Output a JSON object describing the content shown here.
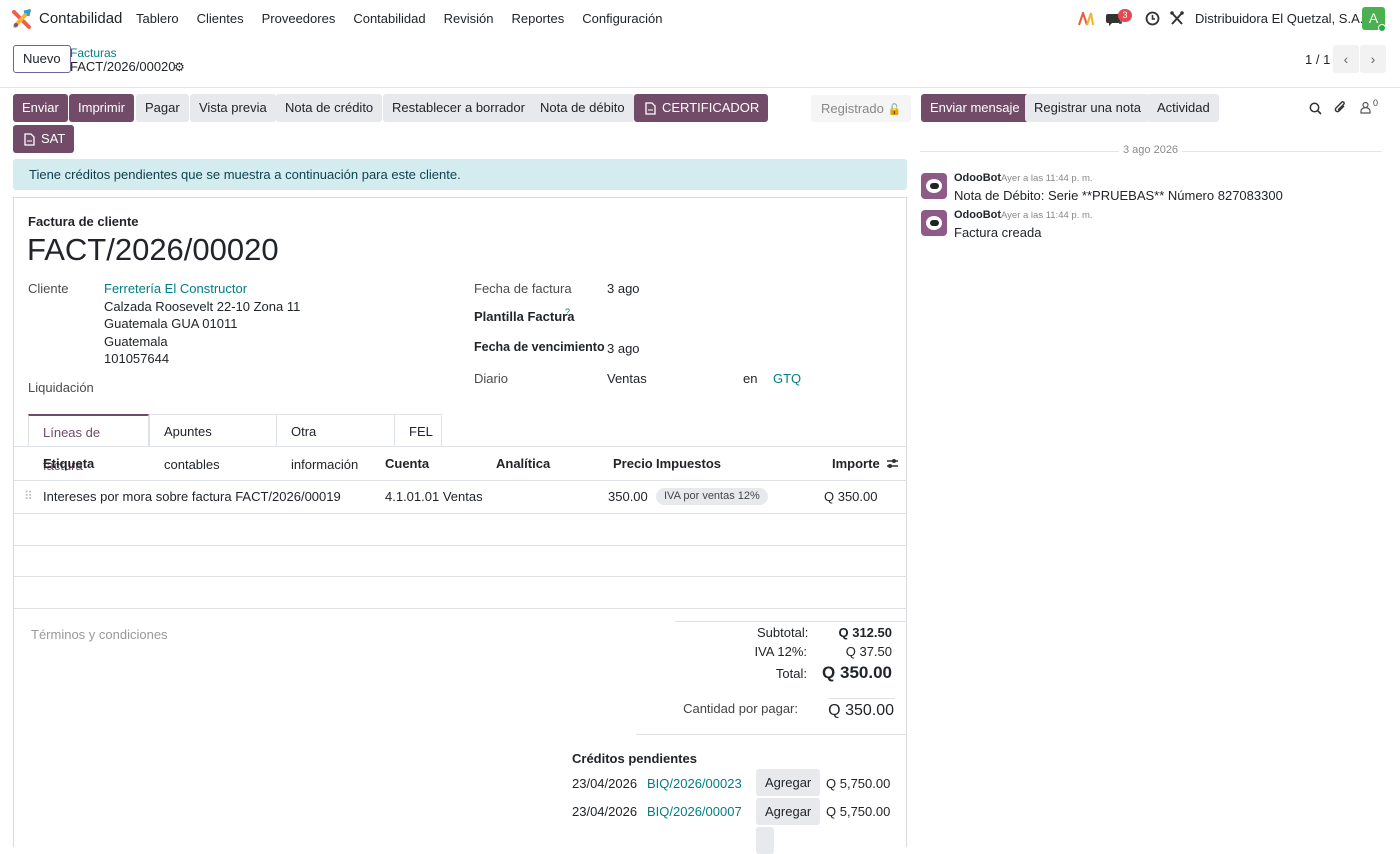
{
  "nav": {
    "app_name": "Contabilidad",
    "menu": [
      "Tablero",
      "Clientes",
      "Proveedores",
      "Contabilidad",
      "Revisión",
      "Reportes",
      "Configuración"
    ],
    "messages_count": "3",
    "company": "Distribuidora El Quetzal, S.A.",
    "user_initial": "A"
  },
  "control": {
    "new_label": "Nuevo",
    "breadcrumb_parent": "Facturas",
    "breadcrumb_current": "FACT/2026/00020",
    "pager": "1 / 1"
  },
  "actions": {
    "send": "Enviar",
    "print": "Imprimir",
    "pay": "Pagar",
    "preview": "Vista previa",
    "credit_note": "Nota de crédito",
    "reset_draft": "Restablecer a borrador",
    "debit_note": "Nota de débito",
    "certificador": "CERTIFICADOR",
    "sat": "SAT",
    "status": "Registrado"
  },
  "alert": {
    "pre": "Tiene",
    "bold": "créditos pendientes",
    "post": "que se muestra a continuación para este cliente."
  },
  "form": {
    "type_label": "Factura de cliente",
    "number": "FACT/2026/00020",
    "customer_label": "Cliente",
    "customer_name": "Ferretería El Constructor",
    "address1": "Calzada Roosevelt 22-10 Zona 11",
    "address2": "Guatemala GUA 01011",
    "address3": "Guatemala",
    "address4": "101057644",
    "liquidacion_label": "Liquidación",
    "invoice_date_label": "Fecha de factura",
    "invoice_date": "3 ago",
    "template_label": "Plantilla Factura",
    "template_help": "?",
    "due_date_label": "Fecha de vencimiento",
    "due_date": "3 ago",
    "journal_label": "Diario",
    "journal": "Ventas",
    "currency_in": "en",
    "currency": "GTQ"
  },
  "tabs": [
    "Líneas de factura",
    "Apuntes contables",
    "Otra información",
    "FEL"
  ],
  "lines": {
    "headers": [
      "Etiqueta",
      "Cuenta",
      "Analítica",
      "Precio",
      "Impuestos",
      "Importe"
    ],
    "rows": [
      {
        "label": "Intereses por mora sobre factura FACT/2026/00019",
        "account": "4.1.01.01 Ventas",
        "analytic": "",
        "price": "350.00",
        "tax": "IVA por ventas 12%",
        "amount": "Q 350.00"
      }
    ]
  },
  "terms_placeholder": "Términos y condiciones",
  "totals": {
    "subtotal_label": "Subtotal:",
    "subtotal": "Q 312.50",
    "iva_label": "IVA 12%:",
    "iva": "Q 37.50",
    "total_label": "Total:",
    "total": "Q 350.00",
    "due_label": "Cantidad por pagar:",
    "due": "Q 350.00"
  },
  "credits": {
    "title": "Créditos pendientes",
    "add_label": "Agregar",
    "items": [
      {
        "date": "23/04/2026",
        "ref": "BIQ/2026/00023",
        "amount": "Q 5,750.00"
      },
      {
        "date": "23/04/2026",
        "ref": "BIQ/2026/00007",
        "amount": "Q 5,750.00"
      }
    ]
  },
  "chatter": {
    "send_message": "Enviar mensaje",
    "log_note": "Registrar una nota",
    "activity": "Actividad",
    "followers": "0",
    "date_separator": "3 ago 2026",
    "messages": [
      {
        "author": "OdooBot",
        "time": "Ayer a las 11:44 p. m.",
        "body": "Nota de Débito: Serie **PRUEBAS** Número 827083300"
      },
      {
        "author": "OdooBot",
        "time": "Ayer a las 11:44 p. m.",
        "body": "Factura creada"
      }
    ]
  },
  "colors": {
    "primary": "#714b67",
    "link": "#017e84",
    "alert_bg": "#d4ebef"
  }
}
